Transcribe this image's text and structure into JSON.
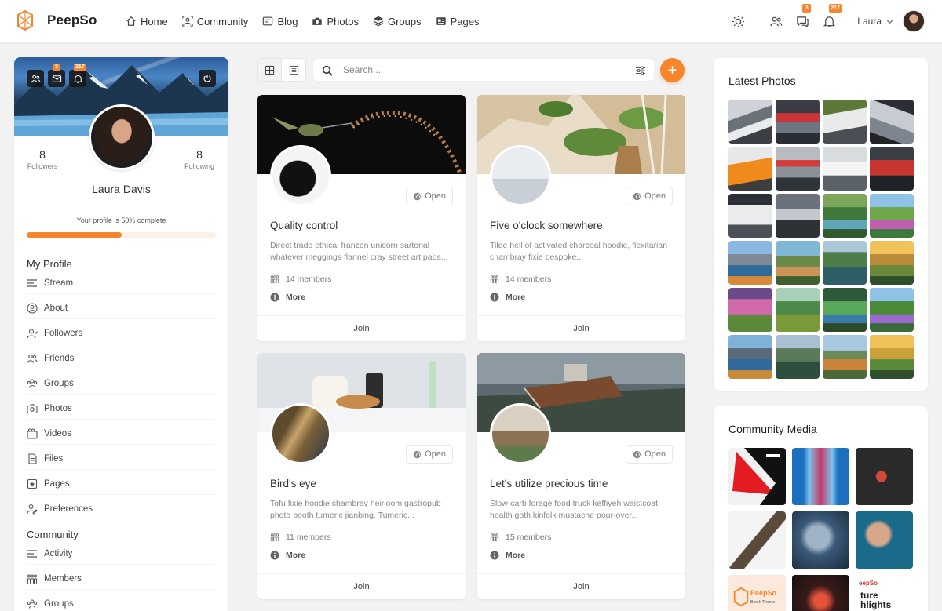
{
  "app": {
    "name": "PeepSo",
    "accent": "#f5862e"
  },
  "nav": [
    {
      "label": "Home",
      "icon": "home-icon"
    },
    {
      "label": "Community",
      "icon": "community-icon"
    },
    {
      "label": "Blog",
      "icon": "blog-icon"
    },
    {
      "label": "Photos",
      "icon": "camera-icon"
    },
    {
      "label": "Groups",
      "icon": "groups-icon"
    },
    {
      "label": "Pages",
      "icon": "pages-icon"
    }
  ],
  "topbar": {
    "messages_badge": "3",
    "notifications_badge": "217",
    "user_name": "Laura"
  },
  "profile": {
    "followers_count": "8",
    "followers_label": "Followers",
    "following_count": "8",
    "following_label": "Following",
    "name": "Laura Davis",
    "completion_text": "Your profile is 50% complete",
    "completion_percent": 50,
    "messages_badge": "3",
    "notifications_badge": "217"
  },
  "my_profile": {
    "title": "My Profile",
    "items": [
      {
        "label": "Stream",
        "icon": "stream-icon"
      },
      {
        "label": "About",
        "icon": "about-icon"
      },
      {
        "label": "Followers",
        "icon": "followers-icon"
      },
      {
        "label": "Friends",
        "icon": "friends-icon"
      },
      {
        "label": "Groups",
        "icon": "groups-icon"
      },
      {
        "label": "Photos",
        "icon": "camera-icon"
      },
      {
        "label": "Videos",
        "icon": "video-icon"
      },
      {
        "label": "Files",
        "icon": "file-icon"
      },
      {
        "label": "Pages",
        "icon": "pages-icon"
      },
      {
        "label": "Preferences",
        "icon": "preferences-icon"
      }
    ]
  },
  "community": {
    "title": "Community",
    "items": [
      {
        "label": "Activity",
        "icon": "activity-icon"
      },
      {
        "label": "Members",
        "icon": "members-icon"
      },
      {
        "label": "Groups",
        "icon": "groups-icon"
      }
    ]
  },
  "search": {
    "placeholder": "Search..."
  },
  "groups": [
    {
      "title": "Quality control",
      "description": "Direct trade ethical franzen unicorn sartorial whatever meggings flannel cray street art pabs...",
      "members": "14 members",
      "open_label": "Open",
      "more_label": "More",
      "join_label": "Join"
    },
    {
      "title": "Five o'clock somewhere",
      "description": "Tilde hell of activated charcoal hoodie, flexitarian chambray fixie bespoke...",
      "members": "14 members",
      "open_label": "Open",
      "more_label": "More",
      "join_label": "Join"
    },
    {
      "title": "Bird's eye",
      "description": "Tofu fixie hoodie chambray heirloom gastropub photo booth tumeric jianbing. Tumeric...",
      "members": "11 members",
      "open_label": "Open",
      "more_label": "More",
      "join_label": "Join"
    },
    {
      "title": "Let's utilize precious time",
      "description": "Slow-carb forage food truck keffiyeh waistcoat health goth kinfolk mustache pour-over...",
      "members": "15 members",
      "open_label": "Open",
      "more_label": "More",
      "join_label": "Join"
    }
  ],
  "latest_photos": {
    "title": "Latest Photos"
  },
  "community_media": {
    "title": "Community Media",
    "captions": {
      "peepso_logo": "PeepSo",
      "peepso_sub": "Block Theme",
      "highlights": "ture\nhlights",
      "highlights_brand": "eepSo"
    }
  }
}
